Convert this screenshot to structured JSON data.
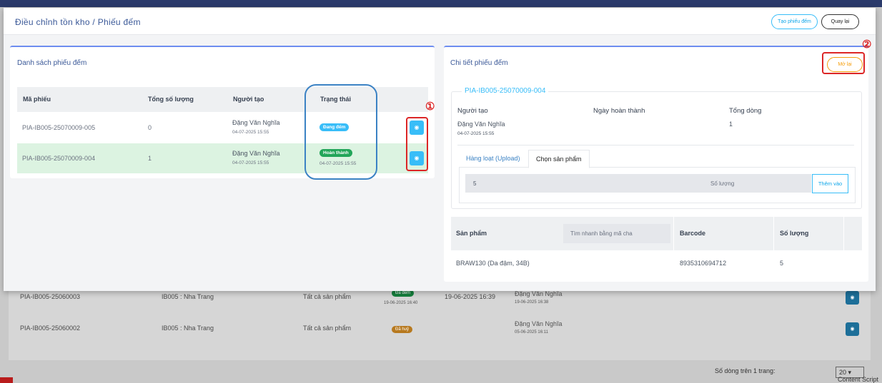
{
  "background": {
    "rows": [
      {
        "code": "PIA-IB005-25060003",
        "store": "IB005 : Nha Trang",
        "scope": "Tất cả sản phẩm",
        "status": "Đã đếm",
        "status_date": "19-06-2025 16:40",
        "done_at": "19-06-2025 16:39",
        "creator": "Đặng Văn Nghĩa",
        "creator_date": "19-06-2025 16:38"
      },
      {
        "code": "PIA-IB005-25060002",
        "store": "IB005 : Nha Trang",
        "scope": "Tất cả sản phẩm",
        "status": "Đã huỷ",
        "status_date": "",
        "done_at": "",
        "creator": "Đặng Văn Nghĩa",
        "creator_date": "05-06-2025 16:11"
      }
    ],
    "footer_label": "Số dòng trên 1 trang:",
    "page_size": "20",
    "content_script": "Content Script"
  },
  "modal": {
    "title": "Điều chỉnh tồn kho / Phiếu đếm",
    "create_button": "Tạo phiếu đếm",
    "back_button": "Quay lại"
  },
  "list": {
    "title": "Danh sách phiếu đếm",
    "columns": [
      "Mã phiếu",
      "Tổng số lượng",
      "Người tạo",
      "Trạng thái"
    ],
    "rows": [
      {
        "code": "PIA-IB005-25070009-005",
        "qty": "0",
        "creator": "Đặng Văn Nghĩa",
        "created": "04-07-2025 15:55",
        "status": "Đang đếm",
        "status_date": ""
      },
      {
        "code": "PIA-IB005-25070009-004",
        "qty": "1",
        "creator": "Đặng Văn Nghĩa",
        "created": "04-07-2025 15:55",
        "status": "Hoàn thành",
        "status_date": "04-07-2025 15:55"
      }
    ]
  },
  "annotations": {
    "marker_1": "①",
    "marker_2": "②"
  },
  "detail": {
    "title": "Chi tiết phiếu đếm",
    "reopen_button": "Mở lại",
    "code": "PIA-IB005-25070009-004",
    "labels": {
      "creator": "Người tạo",
      "completed": "Ngày hoàn thành",
      "total_lines": "Tổng dòng"
    },
    "creator": "Đặng Văn Nghĩa",
    "creator_date": "04-07-2025 15:55",
    "completed": "",
    "total_lines": "1",
    "tabs": [
      "Hàng loạt (Upload)",
      "Chọn sản phẩm"
    ],
    "active_tab": "Chọn sản phẩm",
    "qty_value": "5",
    "qty_placeholder": "Số lượng",
    "add_button": "Thêm vào",
    "product_columns": [
      "Sản phẩm",
      "Barcode",
      "Số lượng"
    ],
    "search_placeholder": "Tìm nhanh bằng mã cha",
    "products": [
      {
        "name": "BRAW130 (Da đậm, 34B)",
        "barcode": "8935310694712",
        "qty": "5"
      }
    ]
  },
  "colors": {
    "accent": "#38bdf8",
    "success": "#22a559",
    "warning": "#f59e0b",
    "annotation_red": "#dc2626",
    "title_blue": "#3b5998"
  }
}
